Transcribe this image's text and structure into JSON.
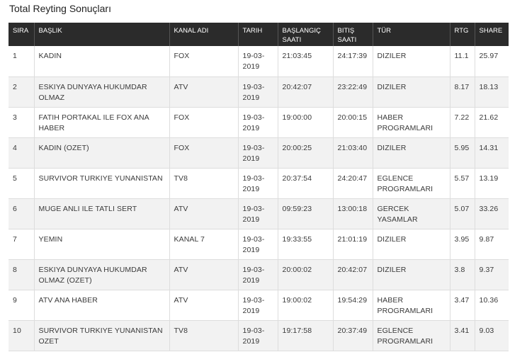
{
  "page": {
    "title": "Total Reyting Sonuçları"
  },
  "table": {
    "headers": {
      "sira": "SIRA",
      "baslik": "BAŞLIK",
      "kanal": "KANAL ADI",
      "tarih": "TARIH",
      "baslangic": "BAŞLANGIÇ SAATI",
      "bitis": "BITIŞ SAATI",
      "tur": "TÜR",
      "rtg": "RTG",
      "share": "SHARE"
    },
    "rows": [
      {
        "sira": "1",
        "baslik": "KADIN",
        "kanal": "FOX",
        "tarih": "19-03-2019",
        "baslangic": "21:03:45",
        "bitis": "24:17:39",
        "tur": "DIZILER",
        "rtg": "11.1",
        "share": "25.97"
      },
      {
        "sira": "2",
        "baslik": "ESKIYA DUNYAYA HUKUMDAR OLMAZ",
        "kanal": "ATV",
        "tarih": "19-03-2019",
        "baslangic": "20:42:07",
        "bitis": "23:22:49",
        "tur": "DIZILER",
        "rtg": "8.17",
        "share": "18.13"
      },
      {
        "sira": "3",
        "baslik": "FATIH PORTAKAL ILE FOX ANA HABER",
        "kanal": "FOX",
        "tarih": "19-03-2019",
        "baslangic": "19:00:00",
        "bitis": "20:00:15",
        "tur": "HABER PROGRAMLARI",
        "rtg": "7.22",
        "share": "21.62"
      },
      {
        "sira": "4",
        "baslik": "KADIN (OZET)",
        "kanal": "FOX",
        "tarih": "19-03-2019",
        "baslangic": "20:00:25",
        "bitis": "21:03:40",
        "tur": "DIZILER",
        "rtg": "5.95",
        "share": "14.31"
      },
      {
        "sira": "5",
        "baslik": "SURVIVOR TURKIYE YUNANISTAN",
        "kanal": "TV8",
        "tarih": "19-03-2019",
        "baslangic": "20:37:54",
        "bitis": "24:20:47",
        "tur": "EGLENCE PROGRAMLARI",
        "rtg": "5.57",
        "share": "13.19"
      },
      {
        "sira": "6",
        "baslik": "MUGE ANLI ILE TATLI SERT",
        "kanal": "ATV",
        "tarih": "19-03-2019",
        "baslangic": "09:59:23",
        "bitis": "13:00:18",
        "tur": "GERCEK YASAMLAR",
        "rtg": "5.07",
        "share": "33.26"
      },
      {
        "sira": "7",
        "baslik": "YEMIN",
        "kanal": "KANAL 7",
        "tarih": "19-03-2019",
        "baslangic": "19:33:55",
        "bitis": "21:01:19",
        "tur": "DIZILER",
        "rtg": "3.95",
        "share": "9.87"
      },
      {
        "sira": "8",
        "baslik": "ESKIYA DUNYAYA HUKUMDAR OLMAZ (OZET)",
        "kanal": "ATV",
        "tarih": "19-03-2019",
        "baslangic": "20:00:02",
        "bitis": "20:42:07",
        "tur": "DIZILER",
        "rtg": "3.8",
        "share": "9.37"
      },
      {
        "sira": "9",
        "baslik": "ATV ANA HABER",
        "kanal": "ATV",
        "tarih": "19-03-2019",
        "baslangic": "19:00:02",
        "bitis": "19:54:29",
        "tur": "HABER PROGRAMLARI",
        "rtg": "3.47",
        "share": "10.36"
      },
      {
        "sira": "10",
        "baslik": "SURVIVOR TURKIYE YUNANISTAN OZET",
        "kanal": "TV8",
        "tarih": "19-03-2019",
        "baslangic": "19:17:58",
        "bitis": "20:37:49",
        "tur": "EGLENCE PROGRAMLARI",
        "rtg": "3.41",
        "share": "9.03"
      }
    ]
  }
}
